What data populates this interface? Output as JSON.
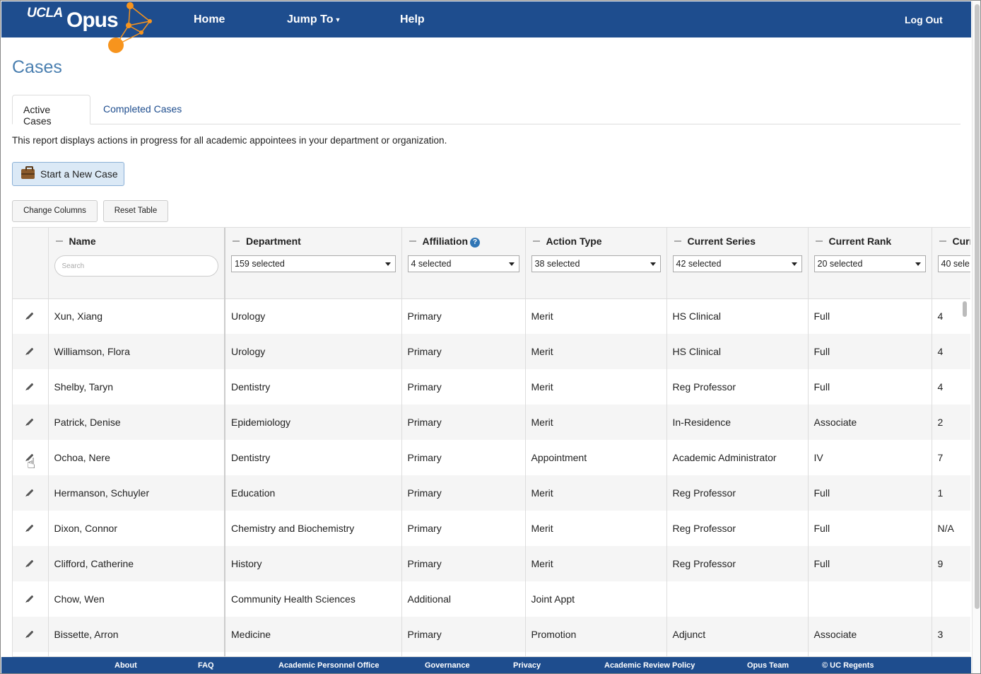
{
  "header": {
    "logo_ucla": "UCLA",
    "logo_opus": "Opus",
    "nav": [
      {
        "label": "Home"
      },
      {
        "label": "Jump To"
      },
      {
        "label": "Help"
      }
    ],
    "logout": "Log Out",
    "brand_color": "#1e4d8e",
    "accent_color": "#f7941d"
  },
  "page": {
    "title": "Cases",
    "tabs": [
      {
        "label": "Active Cases",
        "active": true
      },
      {
        "label": "Completed Cases",
        "active": false
      }
    ],
    "intro": "This report displays actions in progress for all academic appointees in your department or organization.",
    "new_case_button": "Start a New Case",
    "change_columns_button": "Change Columns",
    "reset_table_button": "Reset Table"
  },
  "table": {
    "columns": [
      {
        "label": "Name",
        "filter_placeholder": "Search"
      },
      {
        "label": "Department",
        "filter_value": "159 selected"
      },
      {
        "label": "Affiliation",
        "filter_value": "4 selected"
      },
      {
        "label": "Action Type",
        "filter_value": "38 selected"
      },
      {
        "label": "Current Series",
        "filter_value": "42 selected"
      },
      {
        "label": "Current Rank",
        "filter_value": "20 selected"
      },
      {
        "label": "Curr",
        "filter_value": "40 sele"
      }
    ],
    "rows": [
      {
        "name": "Xun, Xiang",
        "department": "Urology",
        "affiliation": "Primary",
        "action_type": "Merit",
        "series": "HS Clinical",
        "rank": "Full",
        "step": "4"
      },
      {
        "name": "Williamson, Flora",
        "department": "Urology",
        "affiliation": "Primary",
        "action_type": "Merit",
        "series": "HS Clinical",
        "rank": "Full",
        "step": "4"
      },
      {
        "name": "Shelby, Taryn",
        "department": "Dentistry",
        "affiliation": "Primary",
        "action_type": "Merit",
        "series": "Reg Professor",
        "rank": "Full",
        "step": "4"
      },
      {
        "name": "Patrick, Denise",
        "department": "Epidemiology",
        "affiliation": "Primary",
        "action_type": "Merit",
        "series": "In-Residence",
        "rank": "Associate",
        "step": "2"
      },
      {
        "name": "Ochoa, Nere",
        "department": "Dentistry",
        "affiliation": "Primary",
        "action_type": "Appointment",
        "series": "Academic Administrator",
        "rank": "IV",
        "step": "7"
      },
      {
        "name": "Hermanson, Schuyler",
        "department": "Education",
        "affiliation": "Primary",
        "action_type": "Merit",
        "series": "Reg Professor",
        "rank": "Full",
        "step": "1"
      },
      {
        "name": "Dixon, Connor",
        "department": "Chemistry and Biochemistry",
        "affiliation": "Primary",
        "action_type": "Merit",
        "series": "Reg Professor",
        "rank": "Full",
        "step": "N/A"
      },
      {
        "name": "Clifford, Catherine",
        "department": "History",
        "affiliation": "Primary",
        "action_type": "Merit",
        "series": "Reg Professor",
        "rank": "Full",
        "step": "9"
      },
      {
        "name": "Chow, Wen",
        "department": "Community Health Sciences",
        "affiliation": "Additional",
        "action_type": "Joint Appt",
        "series": "",
        "rank": "",
        "step": ""
      },
      {
        "name": "Bissette, Arron",
        "department": "Medicine",
        "affiliation": "Primary",
        "action_type": "Promotion",
        "series": "Adjunct",
        "rank": "Associate",
        "step": "3"
      }
    ]
  },
  "footer": {
    "links": [
      "About",
      "FAQ",
      "Academic Personnel Office",
      "Governance",
      "Privacy",
      "Academic Review Policy",
      "Opus Team",
      "© UC Regents"
    ]
  },
  "icons": {
    "new_case": "briefcase-icon",
    "edit": "pencil-icon",
    "help": "question-circle-icon",
    "pointer": "hand-cursor-icon"
  }
}
